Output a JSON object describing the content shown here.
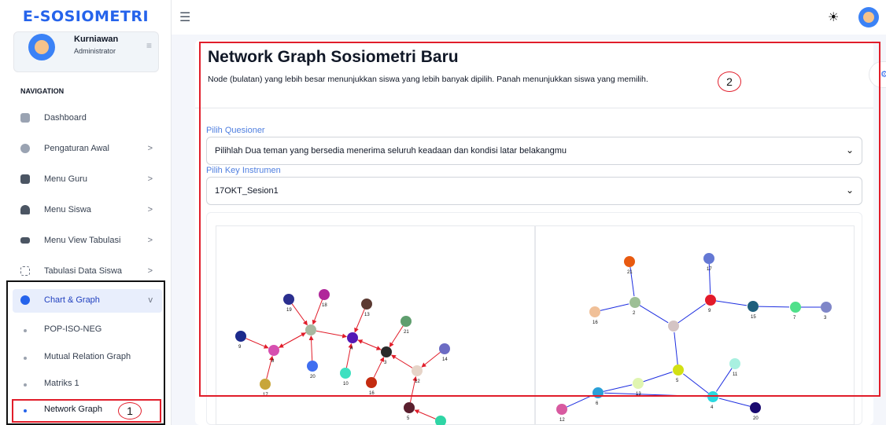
{
  "app": {
    "logo": "E-SOSIOMETRI"
  },
  "sidebar": {
    "user": {
      "name": "Kurniawan",
      "role": "Administrator"
    },
    "nav_heading": "NAVIGATION",
    "items": [
      {
        "label": "Dashboard",
        "chevron": ""
      },
      {
        "label": "Pengaturan Awal",
        "chevron": ">"
      },
      {
        "label": "Menu Guru",
        "chevron": ">"
      },
      {
        "label": "Menu Siswa",
        "chevron": ">"
      },
      {
        "label": "Menu View Tabulasi",
        "chevron": ">"
      },
      {
        "label": "Tabulasi Data Siswa",
        "chevron": ">"
      },
      {
        "label": "Chart & Graph",
        "chevron": "v"
      }
    ],
    "subitems": [
      {
        "label": "POP-ISO-NEG"
      },
      {
        "label": "Mutual Relation Graph"
      },
      {
        "label": "Matriks 1"
      },
      {
        "label": "Network Graph"
      }
    ]
  },
  "annotations": {
    "one": "1",
    "two": "2"
  },
  "main": {
    "title": "Network Graph Sosiometri Baru",
    "subtitle": "Node (bulatan) yang lebih besar menunjukkan siswa yang lebih banyak dipilih. Panah menunjukkan siswa yang memilih.",
    "questioner_label": "Pilih Quesioner",
    "questioner_value": "Pilihlah Dua teman yang bersedia menerima seluruh keadaan dan kondisi latar belakangmu",
    "key_label": "Pilih Key Instrumen",
    "key_value": "17OKT_Sesion1"
  },
  "graphs": [
    {
      "nodes": [
        {
          "id": "19",
          "color": "#2b2f8f"
        },
        {
          "id": "18",
          "color": "#b0279a"
        },
        {
          "id": "13",
          "color": "#5b3a32"
        },
        {
          "id": "9",
          "color": "#1c2a8c"
        },
        {
          "id": "21",
          "color": "#5f9e6e"
        },
        {
          "id": "8",
          "color": "#d64fb0"
        },
        {
          "id": "4",
          "color": "#5418b5"
        },
        {
          "id": "20",
          "color": "#3f6ef0"
        },
        {
          "id": "3",
          "color": "#2a2a2a"
        },
        {
          "id": "14",
          "color": "#6c6cc4"
        },
        {
          "id": "10",
          "color": "#3ee0c0"
        },
        {
          "id": "16",
          "color": "#c42b10"
        },
        {
          "id": "12",
          "color": "#e6d4c8"
        },
        {
          "id": "17",
          "color": "#c8a63a"
        },
        {
          "id": "5",
          "color": "#5a1f2e"
        },
        {
          "id": "C",
          "color": "#a8b8a0"
        },
        {
          "id": "X",
          "color": "#2fd5a5"
        }
      ]
    },
    {
      "nodes": [
        {
          "id": "21",
          "color": "#e85a10"
        },
        {
          "id": "17",
          "color": "#6478d4"
        },
        {
          "id": "16",
          "color": "#f0c098"
        },
        {
          "id": "2",
          "color": "#9dbf95"
        },
        {
          "id": "9",
          "color": "#e31a2a"
        },
        {
          "id": "15",
          "color": "#1e5f7c"
        },
        {
          "id": "7",
          "color": "#4fe08a"
        },
        {
          "id": "3",
          "color": "#7f86c8"
        },
        {
          "id": "C",
          "color": "#d4c4c4"
        },
        {
          "id": "11",
          "color": "#a8f0e0"
        },
        {
          "id": "5",
          "color": "#d2e014"
        },
        {
          "id": "6",
          "color": "#2aa0d8"
        },
        {
          "id": "13",
          "color": "#e0f5b0"
        },
        {
          "id": "4",
          "color": "#2ad8e0"
        },
        {
          "id": "12",
          "color": "#d85aa0"
        },
        {
          "id": "20",
          "color": "#1a0a70"
        }
      ]
    }
  ]
}
